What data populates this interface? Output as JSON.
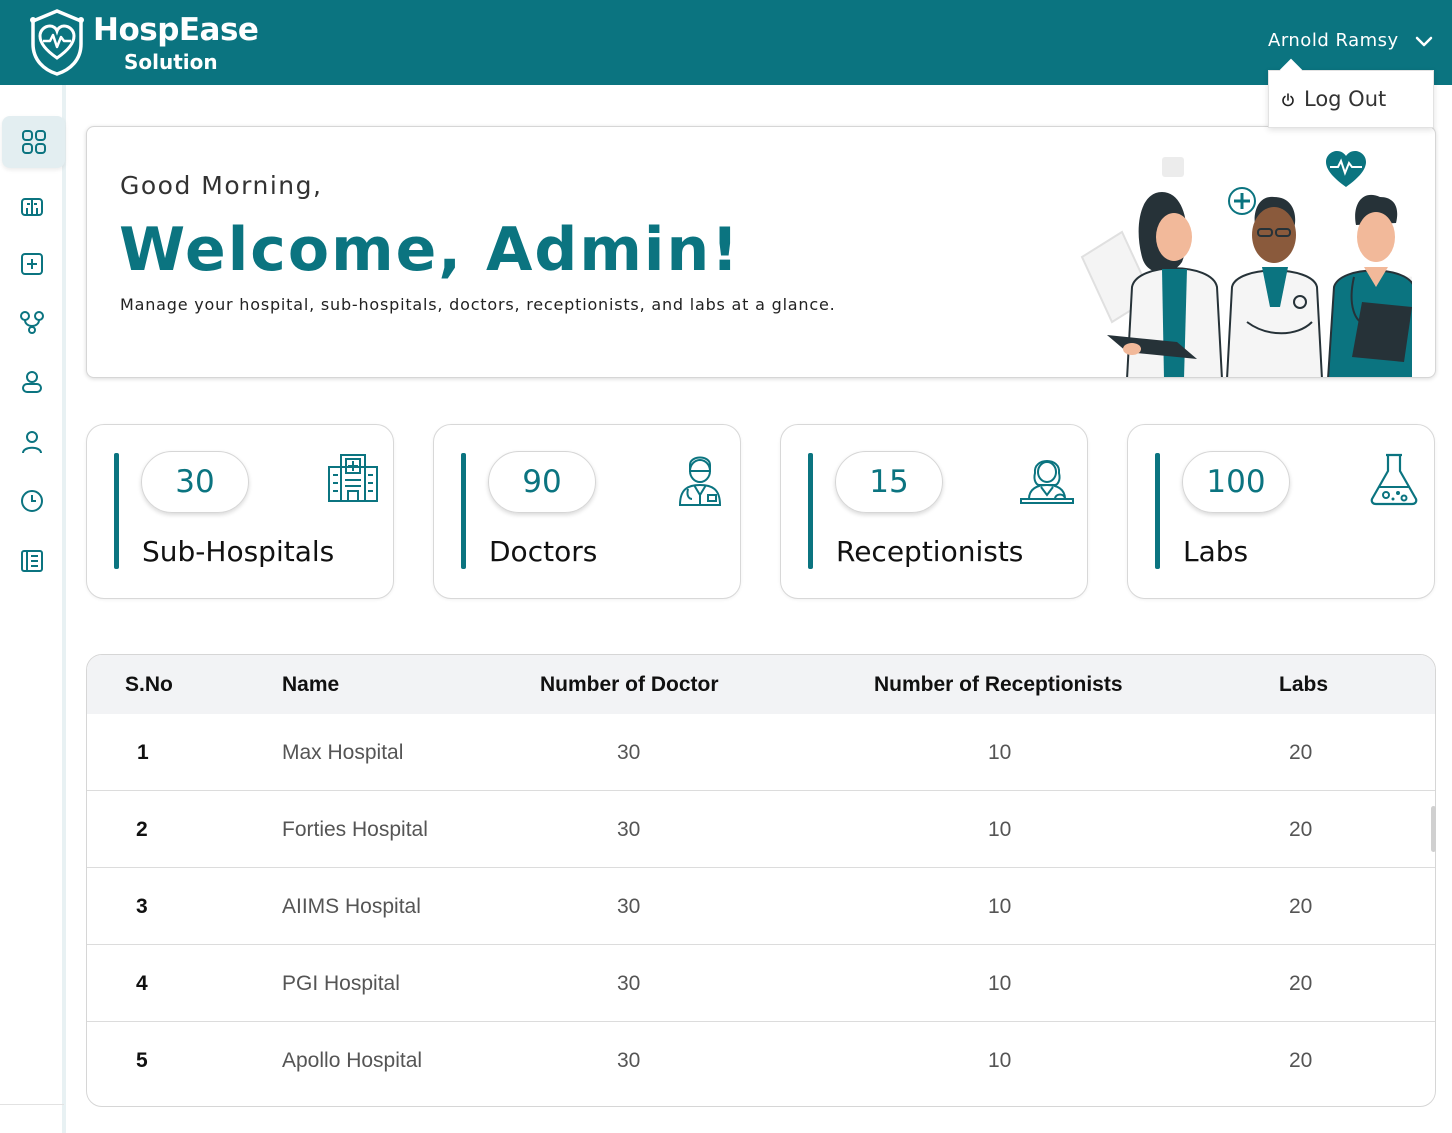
{
  "brand": {
    "name": "HospEase",
    "tagline": "Solution"
  },
  "user": {
    "name": "Arnold Ramsy",
    "menu": {
      "logout_label": "Log Out"
    }
  },
  "sidebar": {
    "items": [
      {
        "name": "dashboard",
        "icon": "grid-icon",
        "active": true
      },
      {
        "name": "sub-hospitals",
        "icon": "hospital-icon",
        "active": false
      },
      {
        "name": "medical",
        "icon": "medical-plus-icon",
        "active": false
      },
      {
        "name": "doctors",
        "icon": "stethoscope-icon",
        "active": false
      },
      {
        "name": "receptionists",
        "icon": "user-outline-icon",
        "active": false
      },
      {
        "name": "patients",
        "icon": "user-icon",
        "active": false
      },
      {
        "name": "history",
        "icon": "clock-icon",
        "active": false
      },
      {
        "name": "records",
        "icon": "ledger-icon",
        "active": false
      }
    ]
  },
  "welcome": {
    "greeting": "Good Morning,",
    "title": "Welcome, Admin!",
    "subtitle": "Manage your hospital, sub-hospitals, doctors, receptionists, and labs at a glance."
  },
  "stats": [
    {
      "value": "30",
      "label": "Sub-Hospitals",
      "icon": "hospital-building-icon"
    },
    {
      "value": "90",
      "label": "Doctors",
      "icon": "doctor-icon"
    },
    {
      "value": "15",
      "label": "Receptionists",
      "icon": "receptionist-icon"
    },
    {
      "value": "100",
      "label": "Labs",
      "icon": "lab-flask-icon"
    }
  ],
  "table": {
    "headers": [
      "S.No",
      "Name",
      "Number of Doctor",
      "Number of Receptionists",
      "Labs"
    ],
    "rows": [
      {
        "sno": "1",
        "name": "Max Hospital",
        "doctors": "30",
        "receptionists": "10",
        "labs": "20"
      },
      {
        "sno": "2",
        "name": "Forties Hospital",
        "doctors": "30",
        "receptionists": "10",
        "labs": "20"
      },
      {
        "sno": "3",
        "name": "AIIMS Hospital",
        "doctors": "30",
        "receptionists": "10",
        "labs": "20"
      },
      {
        "sno": "4",
        "name": "PGI Hospital",
        "doctors": "30",
        "receptionists": "10",
        "labs": "20"
      },
      {
        "sno": "5",
        "name": "Apollo Hospital",
        "doctors": "30",
        "receptionists": "10",
        "labs": "20"
      }
    ]
  },
  "colors": {
    "primary": "#0b7480",
    "table_header_bg": "#f2f3f5",
    "sidebar_active_bg": "#e3eef1"
  }
}
